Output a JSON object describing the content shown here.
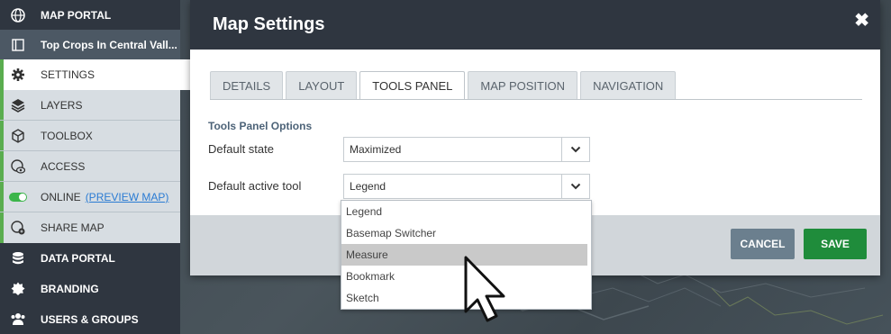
{
  "sidebar": {
    "map_portal": "MAP PORTAL",
    "map_name": "Top Crops In Central Vall...",
    "settings": "SETTINGS",
    "layers": "LAYERS",
    "toolbox": "TOOLBOX",
    "access": "ACCESS",
    "online": "ONLINE",
    "preview_link": "(PREVIEW MAP)",
    "share_map": "SHARE MAP",
    "data_portal": "DATA PORTAL",
    "branding": "BRANDING",
    "users_groups": "USERS & GROUPS",
    "online_toggle_on": true
  },
  "modal": {
    "title": "Map Settings",
    "close_glyph": "✖",
    "tabs": [
      "DETAILS",
      "LAYOUT",
      "TOOLS PANEL",
      "MAP POSITION",
      "NAVIGATION"
    ],
    "active_tab": "TOOLS PANEL",
    "section_title": "Tools Panel Options",
    "default_state_label": "Default state",
    "default_state_value": "Maximized",
    "default_tool_label": "Default active tool",
    "default_tool_value": "Legend",
    "cancel": "CANCEL",
    "save": "SAVE"
  },
  "dropdown": {
    "options": [
      "Legend",
      "Basemap Switcher",
      "Measure",
      "Bookmark",
      "Sketch"
    ],
    "highlighted": "Measure"
  },
  "colors": {
    "sidebar_bg": "#2f3640",
    "accent_green": "#5aad4f",
    "save_green": "#1f8c3b",
    "cancel_slate": "#6b7f8e",
    "link_blue": "#2a7bd3"
  }
}
